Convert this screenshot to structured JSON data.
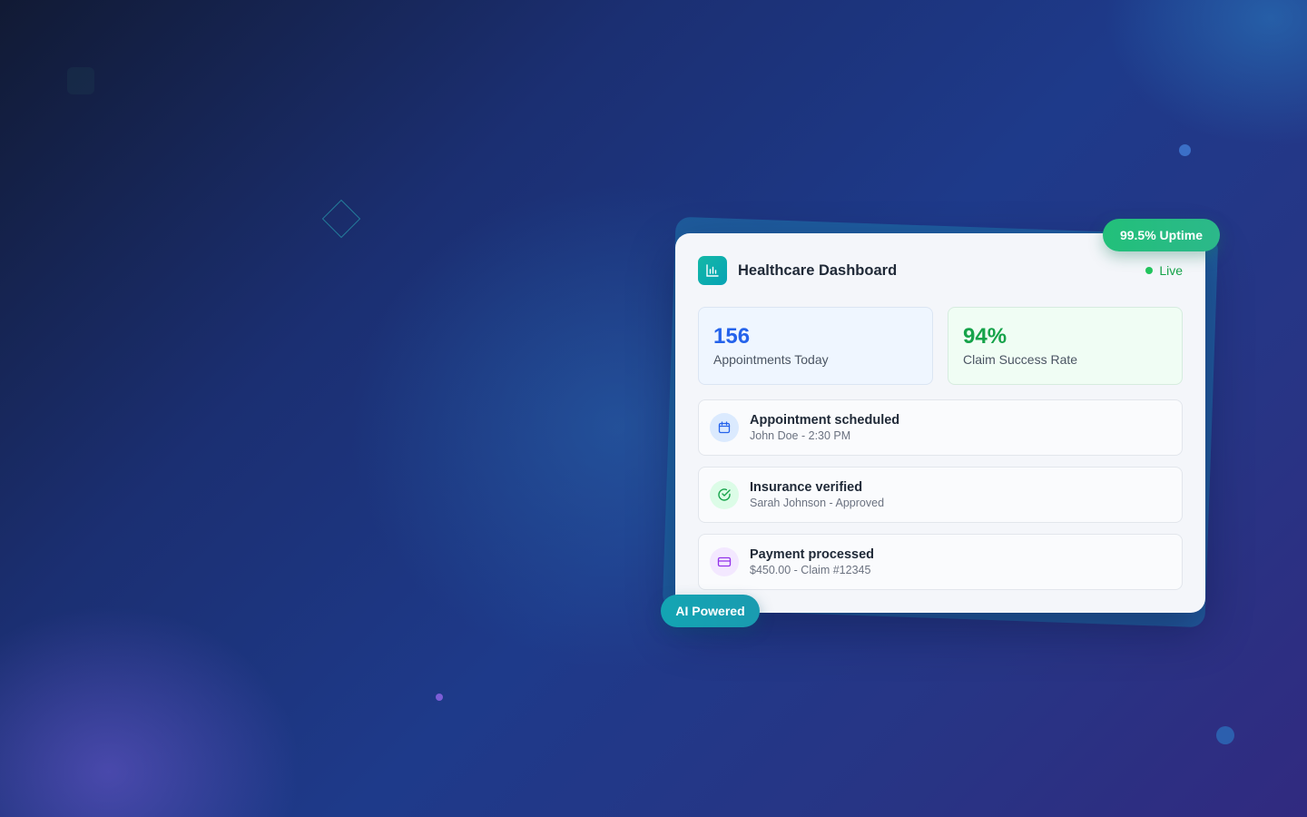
{
  "card": {
    "title": "Healthcare Dashboard",
    "status": "Live",
    "logo_icon": "bar-chart-icon"
  },
  "stats": [
    {
      "value": "156",
      "label": "Appointments Today",
      "color": "#2563eb"
    },
    {
      "value": "94%",
      "label": "Claim Success Rate",
      "color": "#16a34a"
    }
  ],
  "activity": [
    {
      "title": "Appointment scheduled",
      "subtitle": "John Doe - 2:30 PM",
      "icon": "calendar-icon"
    },
    {
      "title": "Insurance verified",
      "subtitle": "Sarah Johnson - Approved",
      "icon": "check-circle-icon"
    },
    {
      "title": "Payment processed",
      "subtitle": "$450.00 - Claim #12345",
      "icon": "credit-card-icon"
    }
  ],
  "badges": {
    "uptime": "99.5% Uptime",
    "ai": "AI Powered"
  },
  "colors": {
    "accent_teal": "#14b8a6",
    "live_green": "#22c55e",
    "primary_blue": "#2563eb",
    "success_green": "#16a34a"
  }
}
